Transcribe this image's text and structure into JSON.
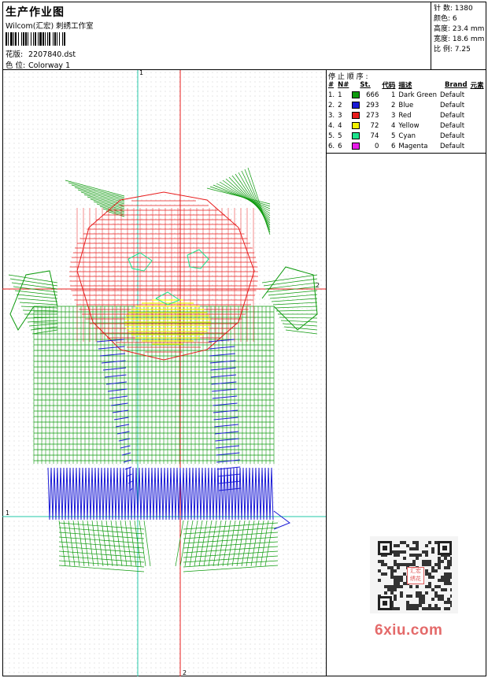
{
  "header": {
    "title": "生产作业图",
    "subtitle": "Wilcom(汇宏) 刺绣工作室",
    "design_label": "花版:",
    "design_value": "2207840.dst",
    "colorway_label": "色 位:",
    "colorway_value": "Colorway 1"
  },
  "stats": [
    {
      "label": "针 数:",
      "value": "1380"
    },
    {
      "label": "颜色:",
      "value": "6"
    },
    {
      "label": "高度:",
      "value": "23.4 mm"
    },
    {
      "label": "宽度:",
      "value": "18.6 mm"
    },
    {
      "label": "比 例:",
      "value": "7.25"
    }
  ],
  "sequence": {
    "title": "停 止 顺 序 :",
    "columns": [
      "#",
      "N#",
      "St.",
      "代码",
      "描述",
      "Brand",
      "元素"
    ],
    "rows": [
      {
        "idx": "1.",
        "n": "1",
        "color": "#0c9a0c",
        "st": "666",
        "code": "1",
        "desc": "Dark Green",
        "brand": "Default"
      },
      {
        "idx": "2.",
        "n": "2",
        "color": "#1a1ad6",
        "st": "293",
        "code": "2",
        "desc": "Blue",
        "brand": "Default"
      },
      {
        "idx": "3.",
        "n": "3",
        "color": "#e81c1c",
        "st": "273",
        "code": "3",
        "desc": "Red",
        "brand": "Default"
      },
      {
        "idx": "4.",
        "n": "4",
        "color": "#f2f200",
        "st": "72",
        "code": "4",
        "desc": "Yellow",
        "brand": "Default"
      },
      {
        "idx": "5.",
        "n": "5",
        "color": "#1de38c",
        "st": "74",
        "code": "5",
        "desc": "Cyan",
        "brand": "Default"
      },
      {
        "idx": "6.",
        "n": "6",
        "color": "#e81ce8",
        "st": "0",
        "code": "6",
        "desc": "Magenta",
        "brand": "Default"
      }
    ]
  },
  "guides": {
    "v1_label": "1",
    "v2_label": "2",
    "h1_label": "1",
    "h2_label": "2"
  },
  "watermark": {
    "text": "6xiu.com",
    "badge": "汇宏绣花"
  },
  "colors": {
    "green": "#0c9a0c",
    "blue": "#1a1ad6",
    "red": "#e81c1c",
    "yellow": "#f2f200",
    "cyan": "#1de38c",
    "guide_cyan": "#22c9a9",
    "guide_red": "#e81c1c"
  }
}
